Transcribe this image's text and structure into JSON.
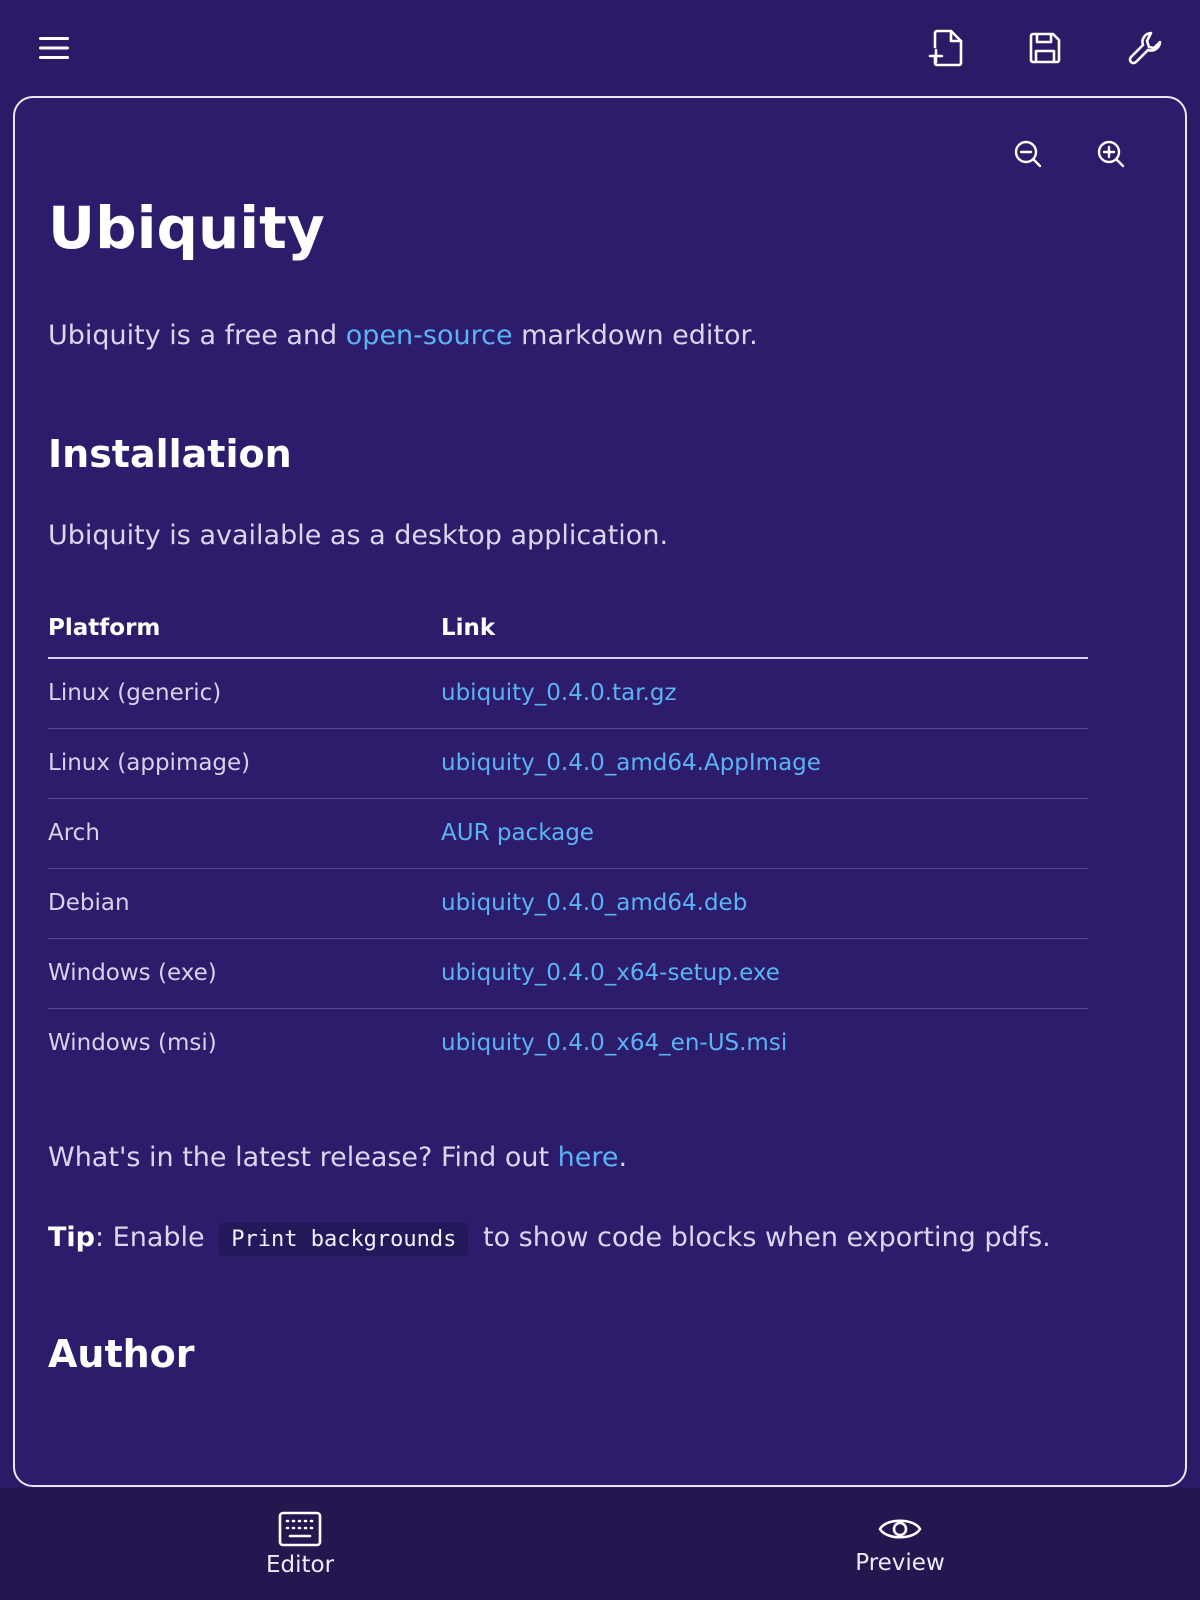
{
  "toolbar": {
    "menu_icon": "hamburger-menu-icon",
    "new_file_icon": "new-file-icon",
    "save_icon": "save-icon",
    "settings_icon": "wrench-icon"
  },
  "zoom": {
    "zoom_out_icon": "zoom-out-icon",
    "zoom_in_icon": "zoom-in-icon"
  },
  "document": {
    "title": "Ubiquity",
    "intro": {
      "before": "Ubiquity is a free and ",
      "link": "open-source",
      "after": " markdown editor."
    },
    "installation_heading": "Installation",
    "availability": "Ubiquity is available as a desktop application.",
    "table": {
      "headers": [
        "Platform",
        "Link"
      ],
      "rows": [
        {
          "platform": "Linux (generic)",
          "link": "ubiquity_0.4.0.tar.gz"
        },
        {
          "platform": "Linux (appimage)",
          "link": "ubiquity_0.4.0_amd64.AppImage"
        },
        {
          "platform": "Arch",
          "link": "AUR package"
        },
        {
          "platform": "Debian",
          "link": "ubiquity_0.4.0_amd64.deb"
        },
        {
          "platform": "Windows (exe)",
          "link": "ubiquity_0.4.0_x64-setup.exe"
        },
        {
          "platform": "Windows (msi)",
          "link": "ubiquity_0.4.0_x64_en-US.msi"
        }
      ]
    },
    "release": {
      "before": "What's in the latest release? Find out ",
      "link": "here",
      "after": "."
    },
    "tip": {
      "label": "Tip",
      "before": ": Enable ",
      "code": "Print backgrounds",
      "after": " to show code blocks when exporting pdfs."
    },
    "author_heading": "Author"
  },
  "bottom_nav": {
    "editor": {
      "label": "Editor",
      "icon": "keyboard-icon"
    },
    "preview": {
      "label": "Preview",
      "icon": "eye-icon"
    }
  },
  "colors": {
    "background": "#2b1b66",
    "link": "#5ab3f5",
    "nav_background": "#24164f"
  }
}
